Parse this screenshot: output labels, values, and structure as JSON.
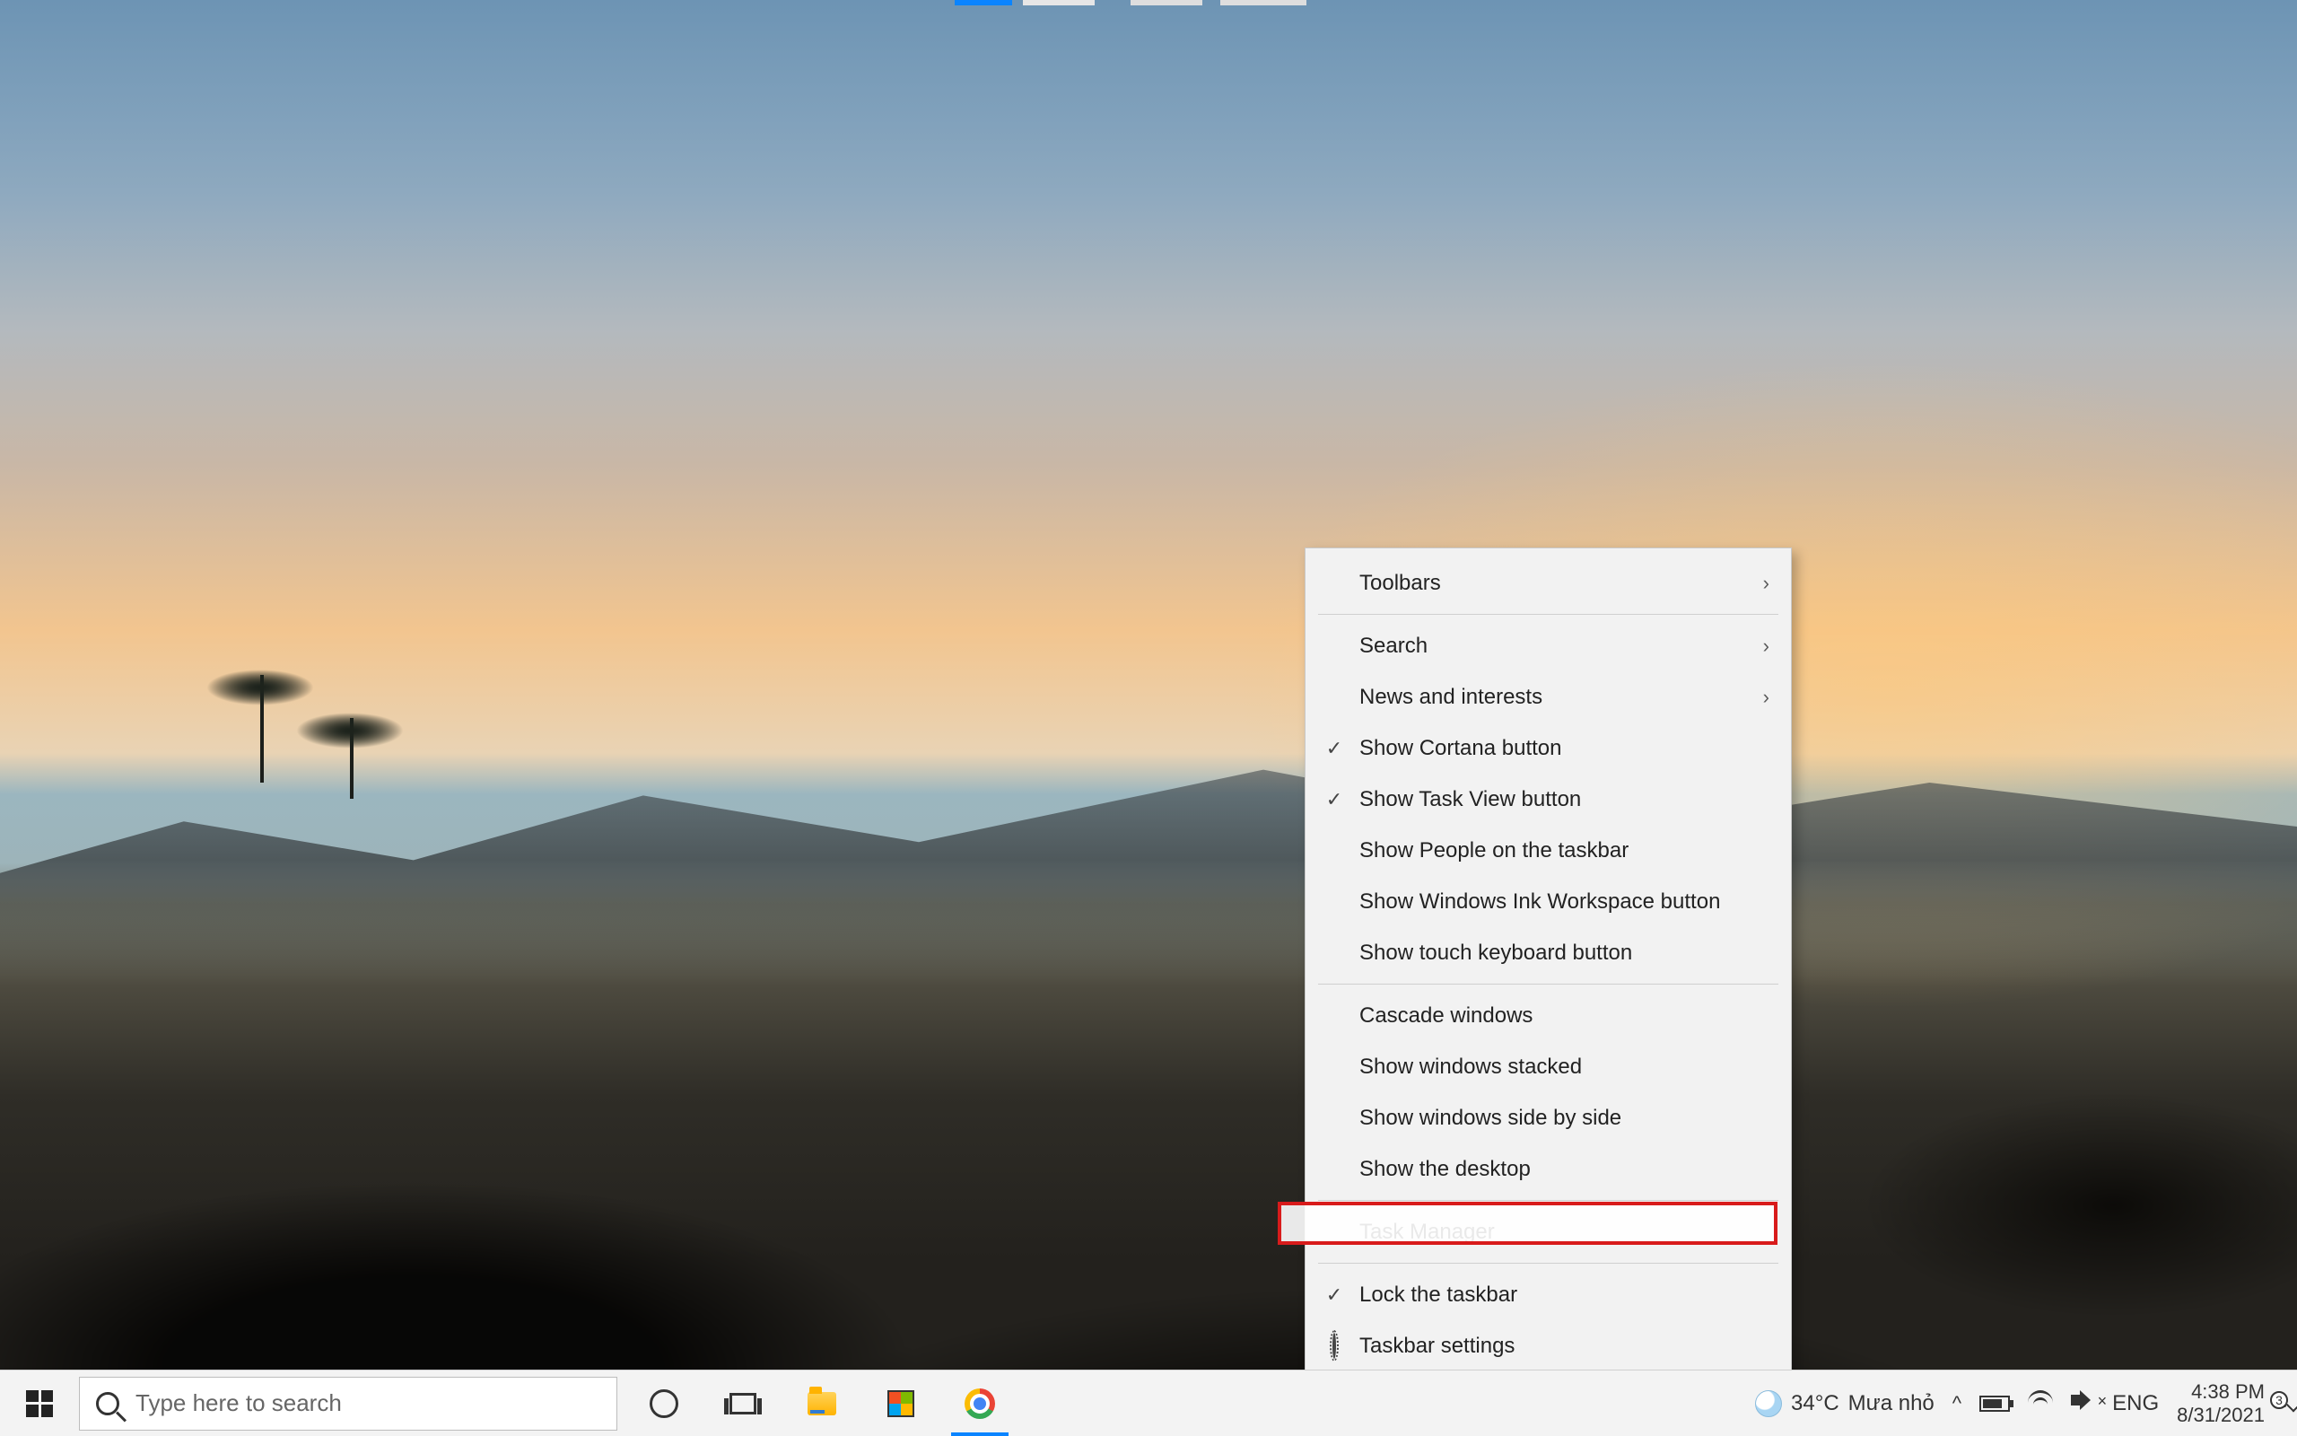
{
  "context_menu": {
    "toolbars": "Toolbars",
    "search": "Search",
    "news": "News and interests",
    "show_cortana": "Show Cortana button",
    "show_taskview": "Show Task View button",
    "show_people": "Show People on the taskbar",
    "show_ink": "Show Windows Ink Workspace button",
    "show_touchkb": "Show touch keyboard button",
    "cascade": "Cascade windows",
    "stacked": "Show windows stacked",
    "sidebyside": "Show windows side by side",
    "show_desktop": "Show the desktop",
    "task_manager": "Task Manager",
    "lock_taskbar": "Lock the taskbar",
    "taskbar_settings": "Taskbar settings"
  },
  "taskbar": {
    "search_placeholder": "Type here to search"
  },
  "tray": {
    "weather_temp": "34°C",
    "weather_text": "Mưa nhỏ",
    "lang": "ENG",
    "time": "4:38 PM",
    "date": "8/31/2021",
    "notif_count": "3"
  }
}
